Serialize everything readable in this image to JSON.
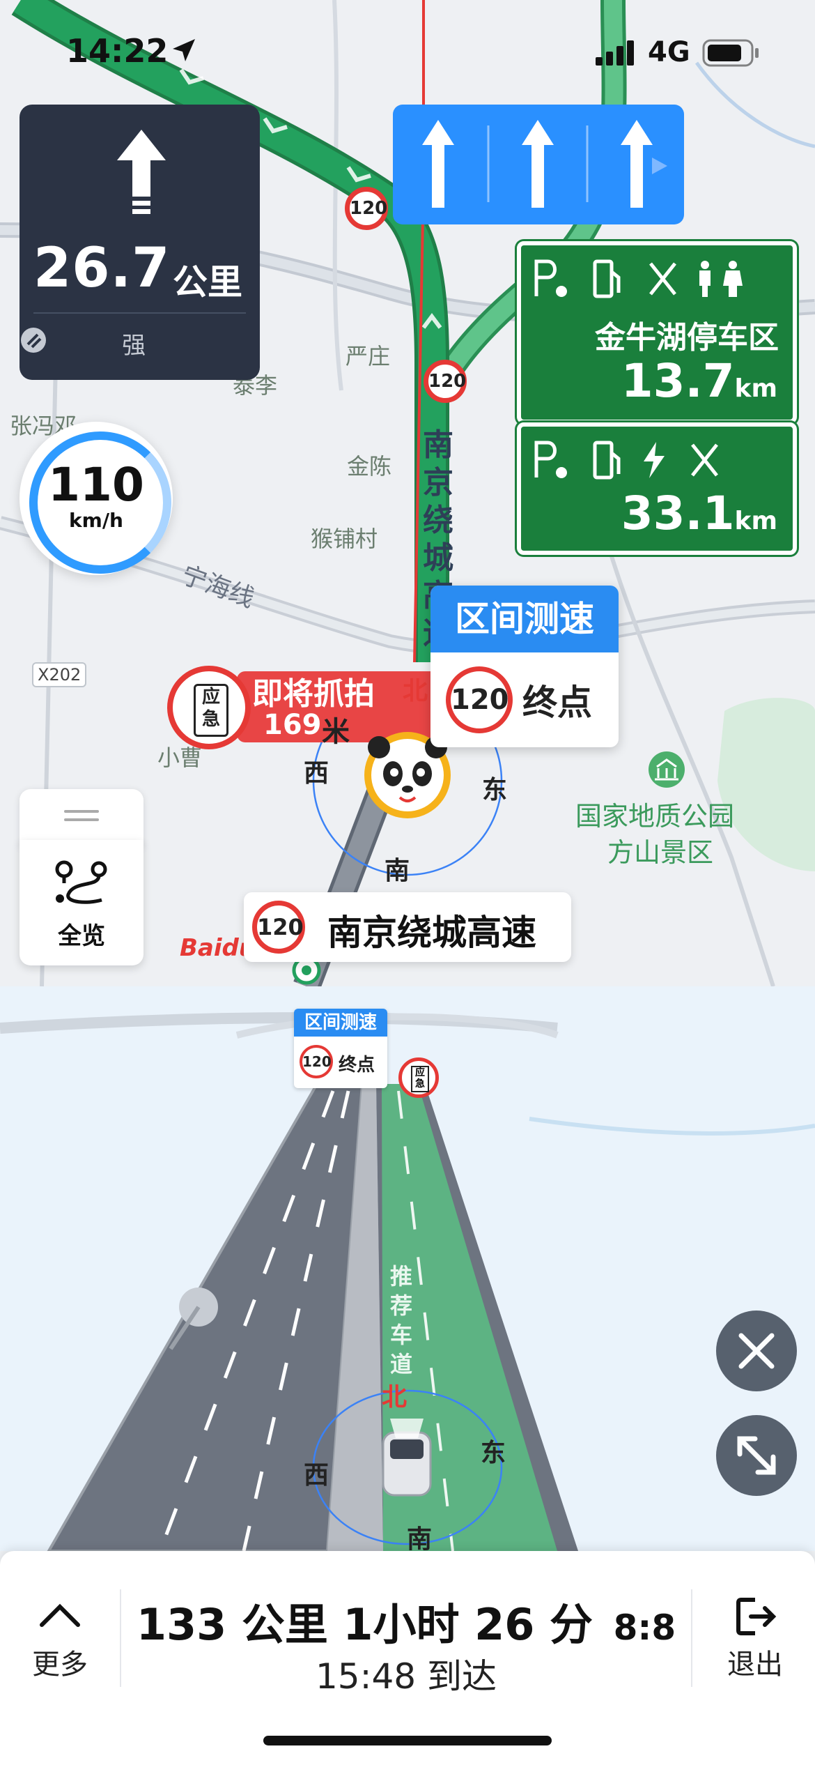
{
  "status_bar": {
    "time": "14:22",
    "network": "4G"
  },
  "turn_card": {
    "distance": "26.7",
    "unit": "公里",
    "signal": "强"
  },
  "lanes": {
    "count": 3,
    "direction": "straight"
  },
  "service_areas": [
    {
      "name": "金牛湖停车区",
      "distance": "13.7",
      "unit": "km",
      "facilities": [
        "parking",
        "fuel",
        "restaurant",
        "restroom"
      ]
    },
    {
      "name": "",
      "distance": "33.1",
      "unit": "km",
      "facilities": [
        "parking",
        "fuel",
        "charging",
        "restaurant"
      ]
    }
  ],
  "speed": {
    "value": "110",
    "unit": "km/h"
  },
  "map_labels": {
    "village1": "严庄",
    "village2": "金陈",
    "village3": "猴铺村",
    "village4": "张冯邓",
    "village5": "泰李",
    "village6": "小曹",
    "railway": "宁海线",
    "road_code": "X202",
    "highway_vertical": "南京绕城高速",
    "speed_limit_1": "120",
    "speed_limit_2": "120",
    "park": "国家地质公园",
    "park2": "方山景区",
    "logo": "Baidu"
  },
  "section_speed": {
    "title": "区间测速",
    "limit": "120",
    "label": "终点"
  },
  "camera_alert": {
    "badge_top": "应",
    "badge_bottom": "急",
    "text": "即将抓拍",
    "distance": "169",
    "unit": "米"
  },
  "compass": {
    "north": "北",
    "east": "东",
    "south": "南",
    "west": "西"
  },
  "overview": {
    "label": "全览"
  },
  "road_name": {
    "limit": "120",
    "name": "南京绕城高速"
  },
  "view3d": {
    "section_title": "区间测速",
    "section_limit": "120",
    "section_label": "终点",
    "recommended_lane": "推荐车道",
    "badge_top": "应",
    "badge_bottom": "急"
  },
  "bottom_bar": {
    "more_label": "更多",
    "summary": "133 公里 1小时 26 分",
    "summary_icon": "8:8",
    "arrival": "15:48 到达",
    "exit_label": "退出"
  },
  "colors": {
    "route_green": "#1a9a55",
    "accent_blue": "#2a8cf2",
    "card_dark": "#2b3344",
    "sign_green": "#1a7f3c",
    "alert_red": "#e84545"
  }
}
